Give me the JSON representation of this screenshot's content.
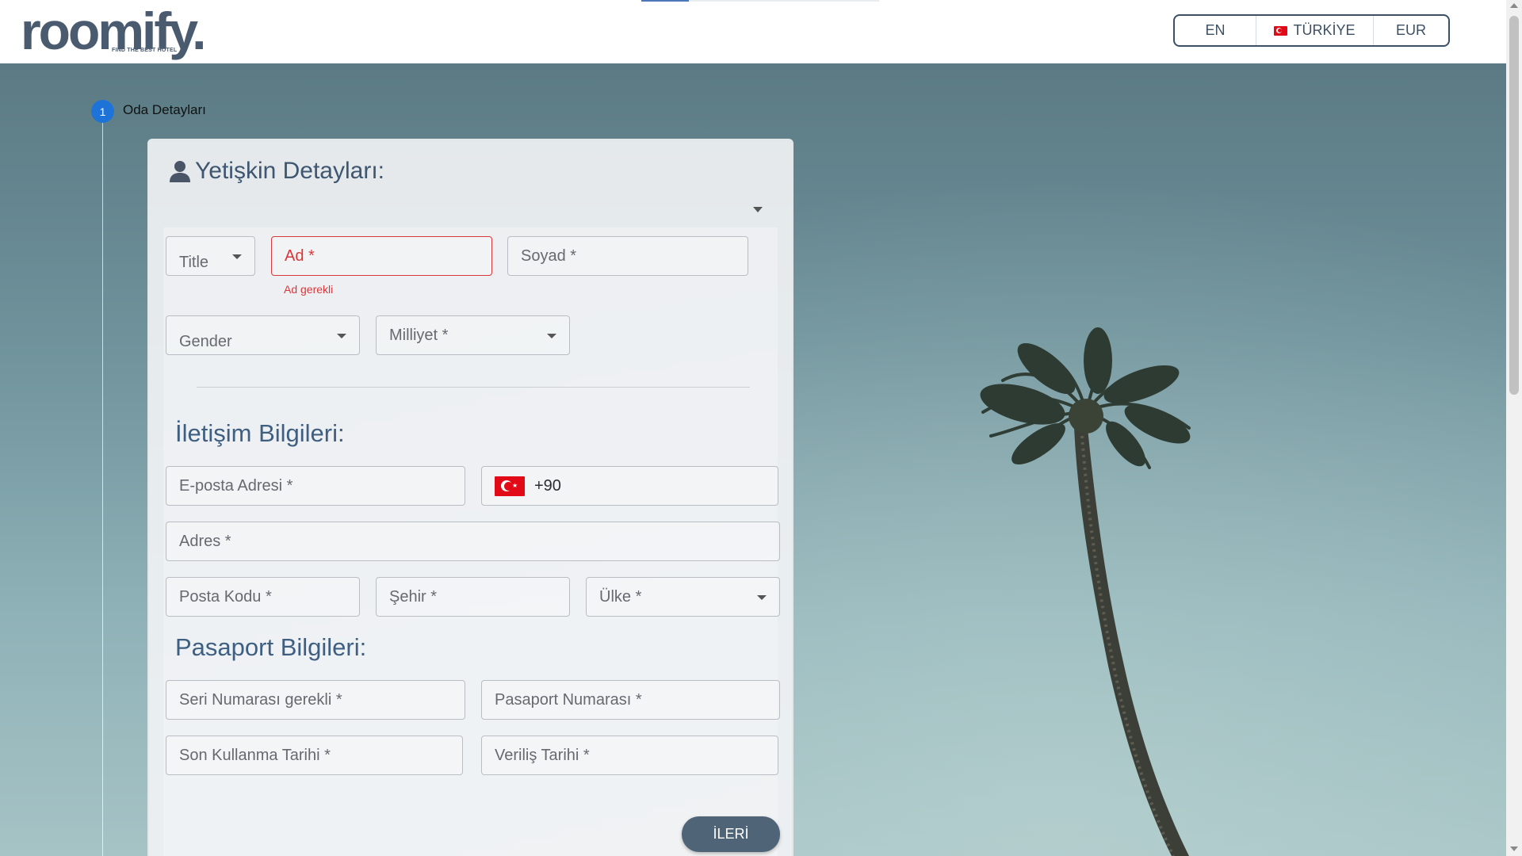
{
  "header": {
    "logo_text": "roomify.",
    "logo_tagline": "FIND THE BEST HOTEL",
    "language": "EN",
    "country": "TÜRKİYE",
    "currency": "EUR"
  },
  "stepper": {
    "step_number": "1",
    "step_label": "Oda Detayları"
  },
  "adult_details": {
    "title": "Yetişkin Detayları:",
    "title_select": "Title",
    "first_name_placeholder": "Ad *",
    "first_name_error": "Ad gerekli",
    "last_name_placeholder": "Soyad *",
    "gender_select": "Gender",
    "nationality_select": "Milliyet *"
  },
  "contact": {
    "title": "İletişim Bilgileri:",
    "email_placeholder": "E-posta Adresi *",
    "phone_code": "+90",
    "address_placeholder": "Adres *",
    "postal_code_placeholder": "Posta Kodu *",
    "city_placeholder": "Şehir *",
    "country_select": "Ülke *"
  },
  "passport": {
    "title": "Pasaport Bilgileri:",
    "serial_placeholder": "Seri Numarası gerekli *",
    "passport_number_placeholder": "Pasaport Numarası *",
    "expiry_placeholder": "Son Kullanma Tarihi *",
    "issue_date_placeholder": "Veriliş Tarihi *"
  },
  "actions": {
    "next_label": "İLERİ"
  },
  "colors": {
    "brand": "#4a5b70",
    "accent_blue": "#1e73d8",
    "error": "#d8383b",
    "button": "#4f6577",
    "section_title": "#3e5f82"
  },
  "icons": {
    "person": "person-icon",
    "dropdown": "chevron-down-icon",
    "flag": "turkey-flag-icon"
  }
}
